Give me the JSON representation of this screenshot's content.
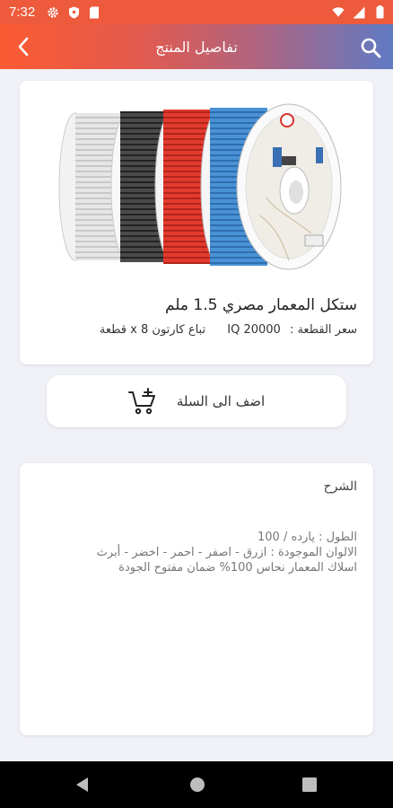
{
  "status_bar": {
    "time": "7:32",
    "icons": [
      "gear-icon",
      "shield-icon",
      "sd-card-icon",
      "wifi-icon",
      "signal-icon",
      "battery-icon"
    ]
  },
  "app_bar": {
    "title": "تفاصيل المنتج",
    "back_icon": "chevron-left-icon",
    "search_icon": "search-icon",
    "gradient": [
      "#fb5b32",
      "#5f7ac4"
    ]
  },
  "product": {
    "name": "ستكل المعمار مصري 1.5 ملم",
    "price_label": "سعر القطعة :",
    "price": "IQ 20000",
    "pack_note": "تباع كارتون x 8 قطعة",
    "image_alt": "cable-spools-image",
    "spool_colors": [
      "#e8e8e8",
      "#3a3a3a",
      "#d9322b",
      "#3a86cc"
    ]
  },
  "cart_button": {
    "label": "اضف الى السلة",
    "icon": "add-to-cart-icon"
  },
  "description": {
    "title": "الشرح",
    "lines": [
      "الطول : يارده / 100",
      "الالوان الموجودة : ازرق - اصفر - احمر - اخضر - أبرث",
      "اسلاك المعمار نحاس 100% ضمان مفتوح الجودة"
    ]
  },
  "nav_bar": {
    "icons": [
      "nav-back-icon",
      "nav-home-icon",
      "nav-recents-icon"
    ]
  }
}
